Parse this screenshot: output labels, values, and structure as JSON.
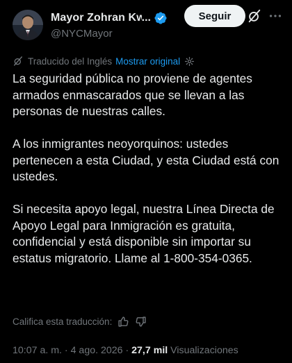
{
  "author": {
    "display_name": "Mayor Zohran Kwa",
    "truncation": "...",
    "handle": "@NYCMayor",
    "verified_color": "#1d9bf0"
  },
  "header": {
    "follow_label": "Seguir"
  },
  "translation": {
    "label": "Traducido del Inglés",
    "show_original": "Mostrar original",
    "rate_label": "Califica esta traducción:"
  },
  "tweet": {
    "paragraphs": [
      "La seguridad pública no proviene de agentes armados enmascarados que se llevan a las personas de nuestras calles.",
      "A los inmigrantes neoyorquinos: ustedes pertenecen a esta Ciudad, y esta Ciudad está con ustedes.",
      "Si necesita apoyo legal, nuestra Línea Directa de Apoyo Legal para Inmigración es gratuita, confidencial y está disponible sin importar su estatus migratorio. Llame al 1-800-354-0365."
    ]
  },
  "meta": {
    "time": "10:07 a. m.",
    "separator": " · ",
    "date": "4 ago. 2026",
    "views_count": "27,7 mil",
    "views_label": "Visualizaciones"
  },
  "colors": {
    "background": "#000000",
    "text": "#e7e9ea",
    "muted": "#71767b",
    "accent": "#1d9bf0"
  }
}
